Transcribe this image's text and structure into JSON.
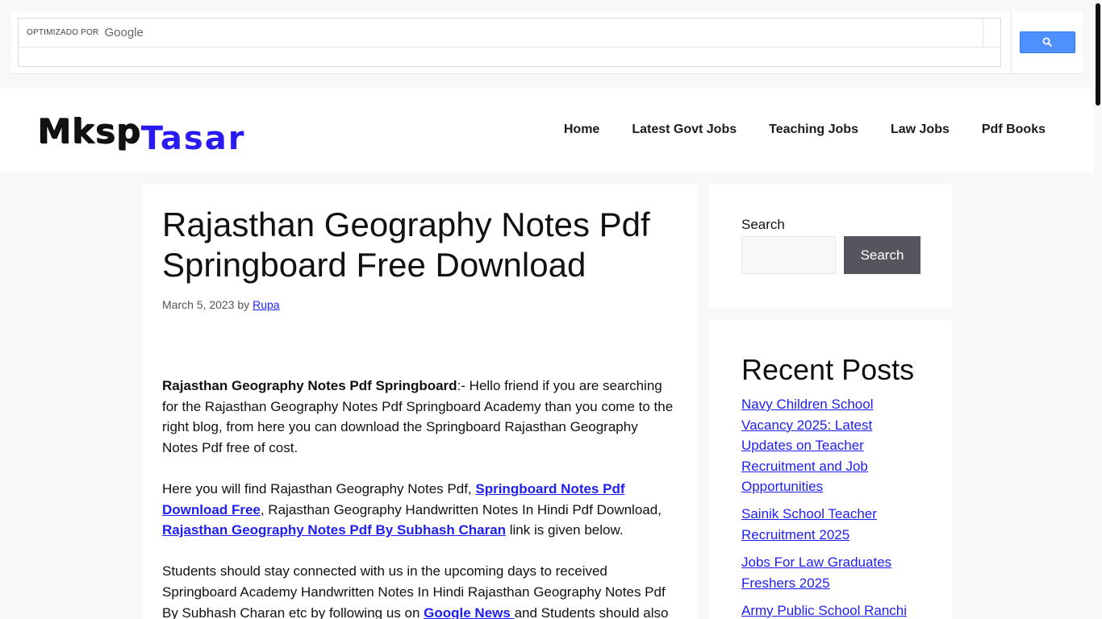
{
  "cse": {
    "brand_prefix": "OPTIMIZADO POR",
    "brand_name": "Google",
    "search_icon": "search-icon"
  },
  "site": {
    "logo_part1": "Mksp",
    "logo_part2": "Tasar",
    "nav": [
      "Home",
      "Latest Govt Jobs",
      "Teaching Jobs",
      "Law Jobs",
      "Pdf Books"
    ]
  },
  "article": {
    "title": "Rajasthan Geography Notes Pdf Springboard Free Download",
    "date": "March 5, 2023",
    "by": "by",
    "author": "Rupa",
    "p1_strong": "Rajasthan Geography Notes Pdf Springboard",
    "p1_rest": ":- Hello friend if you are searching for the Rajasthan Geography Notes Pdf Springboard Academy than you come to the right blog, from here you can download the Springboard Rajasthan Geography Notes Pdf free of cost.",
    "p2_a": "Here you will find Rajasthan Geography Notes Pdf, ",
    "p2_link1": "Springboard Notes Pdf Download Free",
    "p2_b": ", Rajasthan Geography Handwritten Notes In Hindi Pdf Download, ",
    "p2_link2": "Rajasthan Geography Notes Pdf By Subhash Charan",
    "p2_c": " link is given below.",
    "p3_a": "Students should stay connected with us in the upcoming days to received Springboard Academy Handwritten Notes In Hindi Rajasthan Geography Notes Pdf By Subhash Charan etc by following us on ",
    "p3_link": "Google News ",
    "p3_b": "and Students should also"
  },
  "sidebar": {
    "search_label": "Search",
    "search_button": "Search",
    "recent_title": "Recent Posts",
    "recent": [
      "Navy Children School Vacancy 2025: Latest Updates on Teacher Recruitment and Job Opportunities",
      "Sainik School Teacher Recruitment 2025",
      "Jobs For Law Graduates Freshers 2025",
      "Army Public School Ranchi"
    ]
  },
  "colors": {
    "link": "#1e1ef0",
    "logo_accent": "#2a1cf0",
    "cse_button": "#4d90fe",
    "search_button": "#55555e"
  }
}
